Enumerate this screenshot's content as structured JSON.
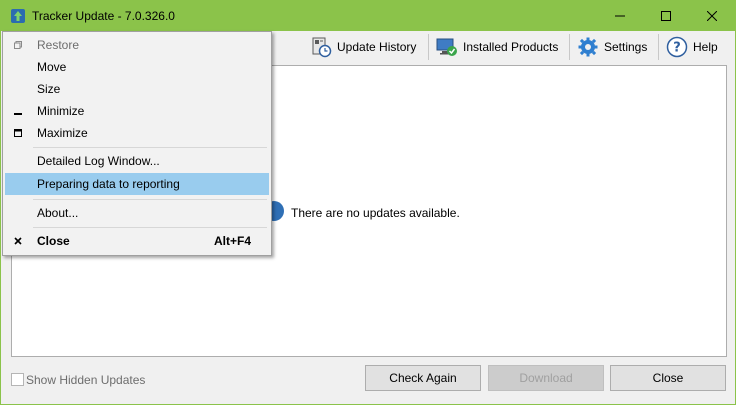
{
  "window": {
    "title": "Tracker Update - 7.0.326.0",
    "controls": {
      "minimize_icon": "minimize-icon",
      "maximize_icon": "maximize-icon",
      "close_icon": "close-icon"
    },
    "accent_color": "#8bc34a"
  },
  "toolbar": {
    "update_history_label": "Update History",
    "installed_products_label": "Installed Products",
    "settings_label": "Settings",
    "help_label": "Help"
  },
  "main": {
    "message": "There are no updates available."
  },
  "footer": {
    "show_hidden_label": "Show Hidden Updates",
    "check_again_label": "Check Again",
    "download_label": "Download",
    "close_label": "Close"
  },
  "system_menu": {
    "items": [
      {
        "label": "Restore",
        "icon": "restore-icon"
      },
      {
        "label": "Move"
      },
      {
        "label": "Size"
      },
      {
        "label": "Minimize",
        "icon": "minimize-icon"
      },
      {
        "label": "Maximize",
        "icon": "maximize-icon"
      },
      {
        "label": "Detailed Log Window..."
      },
      {
        "label": "Preparing data to reporting"
      },
      {
        "label": "About..."
      },
      {
        "label": "Close",
        "icon": "close-icon",
        "shortcut": "Alt+F4"
      }
    ],
    "highlight_color": "#99ccee"
  }
}
